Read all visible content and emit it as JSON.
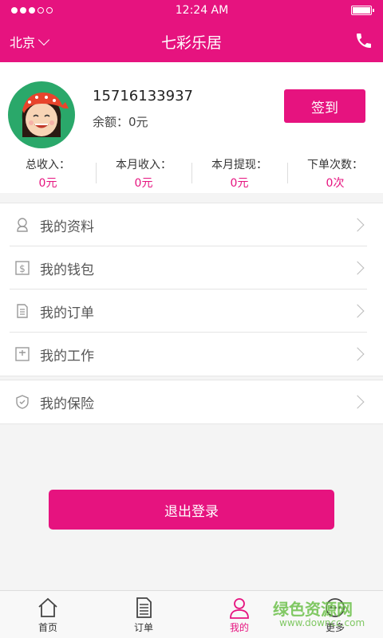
{
  "status_bar": {
    "time": "12:24 AM"
  },
  "header": {
    "city": "北京",
    "title": "七彩乐居"
  },
  "profile": {
    "phone": "15716133937",
    "balance": "余额：0元",
    "checkin_label": "签到"
  },
  "stats": [
    {
      "label": "总收入：",
      "value": "0元"
    },
    {
      "label": "本月收入：",
      "value": "0元"
    },
    {
      "label": "本月提现：",
      "value": "0元"
    },
    {
      "label": "下单次数：",
      "value": "0次"
    }
  ],
  "menu": [
    {
      "label": "我的资料",
      "icon": "user-icon"
    },
    {
      "label": "我的钱包",
      "icon": "wallet-icon"
    },
    {
      "label": "我的订单",
      "icon": "document-icon"
    },
    {
      "label": "我的工作",
      "icon": "work-icon"
    },
    {
      "label": "我的保险",
      "icon": "shield-icon"
    }
  ],
  "logout_label": "退出登录",
  "tabs": [
    {
      "label": "首页",
      "icon": "home-icon"
    },
    {
      "label": "订单",
      "icon": "order-icon"
    },
    {
      "label": "我的",
      "icon": "person-icon",
      "active": true
    },
    {
      "label": "更多",
      "icon": "more-icon"
    }
  ],
  "watermark": {
    "text": "绿色资源网",
    "sub": "www.downcc.com"
  },
  "colors": {
    "accent": "#e6137f"
  }
}
